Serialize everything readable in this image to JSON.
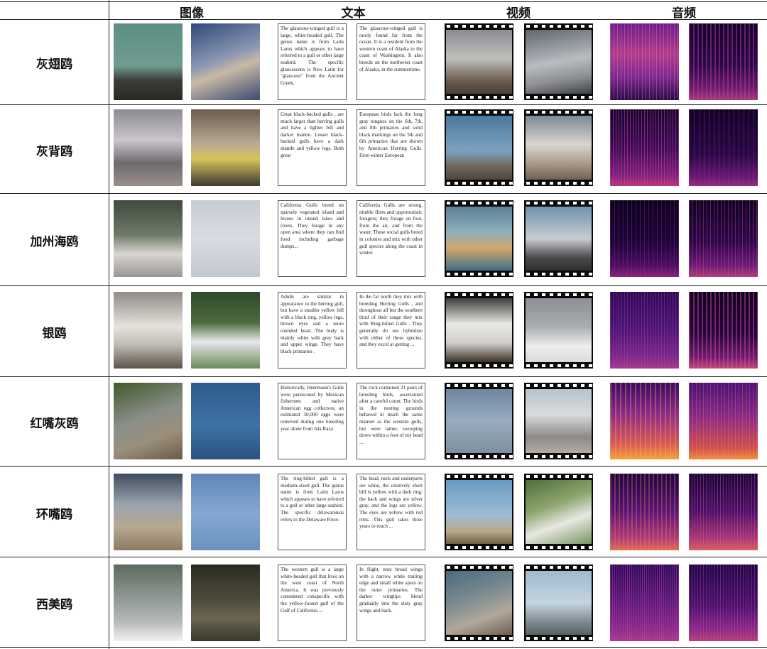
{
  "headers": {
    "image": "图像",
    "text": "文本",
    "video": "视频",
    "audio": "音频"
  },
  "rows": [
    {
      "species": "灰翅鸥",
      "text1": "The glaucous-winged gull is a large, white-headed gull. The genus name is from Latin Larus which appears to have referred to a gull or other large seabird. The specific glaucescens is New Latin for \"glaucous\" from the Ancient Greek,",
      "text2": "The glaucous-winged gull is rarely found far from the ocean. It is a resident from the western coast of Alaska to the coast of Washington. It also breeds on the northwest coast of Alaska, in the summertime."
    },
    {
      "species": "灰背鸥",
      "text1": "Great black-backed gulls , are much larger than herring gulls and have a lighter bill and darker mantle. Lesser black-backed gulls have a dark mantle and yellow legs. Both great",
      "text2": "European birds lack the long gray tongues on the 6th, 7th, and 8th primaries and solid black markings on the 5th and 6th primaries that are shown by American Herring Gulls. First-winter European"
    },
    {
      "species": "加州海鸥",
      "text1": "California Gulls breed on sparsely vegetated island and levees in inland lakes and rivers. They forage in any open area where they can find food including garbage dumps...",
      "text2": "California Gulls are strong, nimble fliers and opportunistic foragers; they forage on foot, from the air, and from the water. These social gulls breed in colonies and mix with other gull species along the coast in winter."
    },
    {
      "species": "银鸥",
      "text1": "Adults are similar in appearance to the herring gull, but have a smaller yellow bill with a black ring, yellow legs, brown eyes and a more rounded head. The body is mainly white with grey back and upper wings. They have black primaries .",
      "text2": "In the far north they mix with breeding Herring Gulls , and throughout all but the southern third of their range they mix with Ring-billed Gulls . They generally do not hybridize with either of these species, and they excel at getting ..."
    },
    {
      "species": "红嘴灰鸥",
      "text1": "Historically, Heermann's Gulls were persecuted by Mexican fishermen and native American egg collectors, an estimated 50,000 eggs were removed during one breeding year alone from Isla Raza",
      "text2": "The rock contained 31 pairs of breeding birds, ascertained after a careful count. The birds in the nesting grounds behaved in much the same manner as the western gulls, but were tamer, swooping down within a foot of my head ..."
    },
    {
      "species": "环嘴鸥",
      "text1": "The ring-billed gull is a medium-sized gull. The genus name is from Latin Larus which appears to have referred to a gull or other large seabird. The specific delawarensis refers to the Delaware River.",
      "text2": "The head, neck and underparts are white, the relatively short bill is yellow with a dark ring; the back and wings are silver gray, and the legs are yellow. The eyes are yellow with red rims. This gull takes three years to reach ..."
    },
    {
      "species": "西美鸥",
      "text1": "The western gull is a large white-headed gull that lives on the west coast of North America. It was previously considered conspecific with the yellow-footed gull of the Gulf of California ...",
      "text2": "In flight, note broad wings with a narrow white trailing edge and small white spots on the outer primaries. The darker wingtips blend gradually into the slaty gray wings and back."
    }
  ],
  "colors": {
    "rule": "#222222",
    "film": "#0b0b0b",
    "spectro_dark": "#1a0636",
    "spectro_bright": "#f3a23a"
  }
}
